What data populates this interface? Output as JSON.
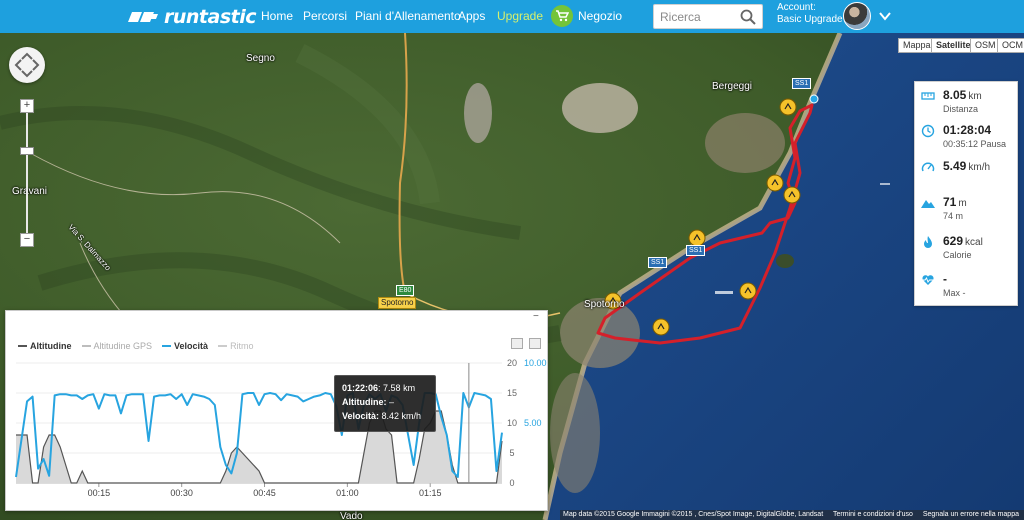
{
  "nav": {
    "brand": "runtastic",
    "links": [
      "Home",
      "Percorsi",
      "Piani d'Allenamento",
      "Apps",
      "Upgrade"
    ],
    "shop_label": "Negozio",
    "search_placeholder": "Ricerca",
    "account_label": "Account:",
    "account_plan": "Basic Upgrade"
  },
  "map": {
    "place_labels": [
      "Segno",
      "Gravani",
      "Bergeggi",
      "Spotorno",
      "Vado"
    ],
    "street_label": "Via S. Dalmazzo",
    "road_shields": [
      "SS1",
      "SS1",
      "SS1",
      "E80"
    ],
    "map_types": [
      "Mappa",
      "Satellite",
      "OSM",
      "OCM"
    ],
    "active_map_type": "Satellite",
    "attribution": [
      "Map data ©2015 Google Immagini ©2015 , Cnes/Spot Image, DigitalGlobe, Landsat",
      "Termini e condizioni d'uso",
      "Segnala un errore nella mappa"
    ]
  },
  "stats": {
    "distance": {
      "value": "8.05",
      "unit": "km",
      "label": "Distanza"
    },
    "duration": {
      "value": "01:28:04",
      "sub": "00:35:12 Pausa"
    },
    "speed": {
      "value": "5.49",
      "unit": "km/h"
    },
    "elevation": {
      "value": "71",
      "unit": "m",
      "sub": "74 m"
    },
    "calories": {
      "value": "629",
      "unit": "kcal",
      "label": "Calorie"
    },
    "heart": {
      "value": "-",
      "label": "Max -"
    }
  },
  "chart": {
    "legend": [
      "Altitudine",
      "Altitudine GPS",
      "Velocità",
      "Ritmo"
    ],
    "tooltip": {
      "time": "01:22:06",
      "distance": "7.58 km",
      "altitude_label": "Altitudine:",
      "altitude": "–",
      "speed_label": "Velocità:",
      "speed": "8.42 km/h"
    }
  },
  "colors": {
    "nav_bg": "#1ea0de",
    "upgrade": "#d7f06c",
    "route": "#d4202a",
    "speed_line": "#27a4e0",
    "altitude_area": "#d9d9d9"
  },
  "chart_data": {
    "type": "line",
    "xlabel": "",
    "x_ticks": [
      "00:15",
      "00:30",
      "00:45",
      "01:00",
      "01:15"
    ],
    "y_left_ticks": [
      0,
      5,
      10,
      15,
      20
    ],
    "y_right_ticks": [
      "5.00",
      "10.00"
    ],
    "ylim_left": [
      0,
      20
    ],
    "ylim_right": [
      0,
      10
    ],
    "x_minutes": [
      0,
      2,
      3,
      4,
      5,
      6,
      7,
      8,
      9,
      10,
      11,
      12,
      13,
      14,
      15,
      16,
      17,
      18,
      19,
      20,
      21,
      22,
      23,
      24,
      25,
      26,
      27,
      28,
      29,
      30,
      31,
      32,
      33,
      34,
      35,
      36,
      37,
      38,
      39,
      40,
      41,
      42,
      43,
      44,
      45,
      46,
      47,
      48,
      49,
      50,
      51,
      52,
      53,
      54,
      55,
      56,
      57,
      58,
      59,
      60,
      61,
      62,
      63,
      64,
      65,
      66,
      67,
      68,
      69,
      70,
      71,
      72,
      73,
      74,
      75,
      76,
      77,
      78,
      79,
      80,
      81,
      82,
      83,
      84,
      85,
      86,
      87,
      88
    ],
    "series": [
      {
        "name": "Velocità",
        "axis": "right",
        "values": [
          0.5,
          6.8,
          7.2,
          1.2,
          2.0,
          0.6,
          7.3,
          7.4,
          7.4,
          7.3,
          7.3,
          7.0,
          7.3,
          7.4,
          6.2,
          7.4,
          7.3,
          7.3,
          5.8,
          7.3,
          7.4,
          7.4,
          7.4,
          3.5,
          7.2,
          7.3,
          7.3,
          7.4,
          7.0,
          7.4,
          6.5,
          7.4,
          7.3,
          7.2,
          7.0,
          6.5,
          3.0,
          1.5,
          0.8,
          2.5,
          7.4,
          7.5,
          7.5,
          6.5,
          7.4,
          7.5,
          7.4,
          6.9,
          7.4,
          7.3,
          7.2,
          6.8,
          7.0,
          7.2,
          7.3,
          7.5,
          7.4,
          6.4,
          4.0,
          7.3,
          7.5,
          4.5,
          6.5,
          7.4,
          7.0,
          7.4,
          6.0,
          7.3,
          7.1,
          6.5,
          4.0,
          1.5,
          5.0,
          7.5,
          7.5,
          7.4,
          5.5,
          4.0,
          1.0,
          0.5,
          7.5,
          6.3,
          7.5,
          7.4,
          7.3,
          7.0,
          1.0,
          4.2
        ]
      },
      {
        "name": "Altitudine",
        "axis": "left",
        "values": [
          8,
          8,
          0,
          0,
          6,
          8,
          8,
          6,
          3,
          0,
          0,
          2,
          0,
          0,
          0,
          0,
          0,
          0,
          0,
          0,
          0,
          0,
          0,
          0,
          0,
          0,
          0,
          0,
          0,
          0,
          0,
          0,
          0,
          0,
          0,
          0,
          0,
          2,
          5,
          6,
          5,
          4,
          3,
          2,
          0,
          0,
          0,
          0,
          0,
          0,
          0,
          0,
          0,
          0,
          0,
          0,
          0,
          0,
          0,
          0,
          0,
          0,
          5,
          10,
          12,
          12,
          9,
          8,
          0,
          0,
          0,
          0,
          4,
          9,
          10,
          12,
          12,
          8,
          3,
          0,
          0,
          0,
          0,
          0,
          0,
          0,
          0,
          7
        ]
      }
    ]
  }
}
